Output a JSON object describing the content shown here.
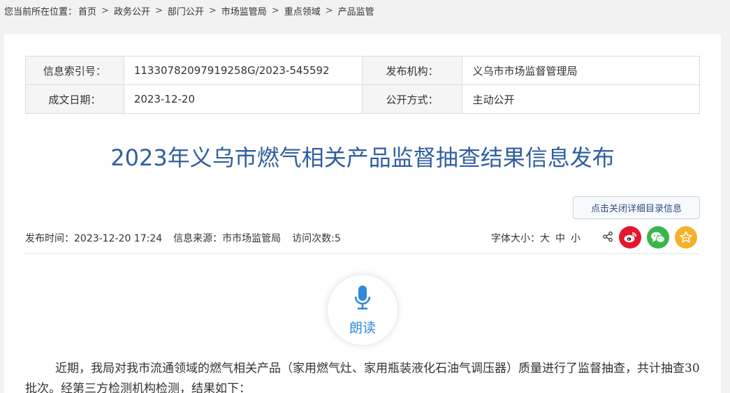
{
  "breadcrumb": {
    "lead": "您当前所在位置：",
    "items": [
      "首页",
      "政务公开",
      "部门公开",
      "市场监管局",
      "重点领域",
      "产品监管"
    ]
  },
  "meta": {
    "index_label": "信息索引号：",
    "index_value": "11330782097919258G/2023-545592",
    "org_label": "发布机构：",
    "org_value": "义乌市市场监督管理局",
    "date_label": "成文日期：",
    "date_value": "2023-12-20",
    "mode_label": "公开方式：",
    "mode_value": "主动公开"
  },
  "article": {
    "title": "2023年义乌市燃气相关产品监督抽查结果信息发布",
    "toggle_label": "点击关闭详细目录信息",
    "publish_time": "发布时间：2023-12-20 17:24",
    "source": "信息来源：市市场监管局",
    "visits": "访问次数:5",
    "fontsize_label": "字体大小：",
    "fontsize_large": "大",
    "fontsize_medium": "中",
    "fontsize_small": "小",
    "read_label": "朗读",
    "body": "近期，我局对我市流通领域的燃气相关产品（家用燃气灶、家用瓶装液化石油气调压器）质量进行了监督抽查，共计抽查30批次。经第三方检测机构检测，结果如下："
  },
  "colors": {
    "title": "#2f5f9f",
    "weibo": "#e6162d",
    "wechat": "#3ab54a",
    "favorite": "#f3b22b",
    "read_accent": "#2f8ad8"
  },
  "icons": [
    "share-icon",
    "weibo-icon",
    "wechat-icon",
    "favorite-icon",
    "microphone-icon"
  ]
}
